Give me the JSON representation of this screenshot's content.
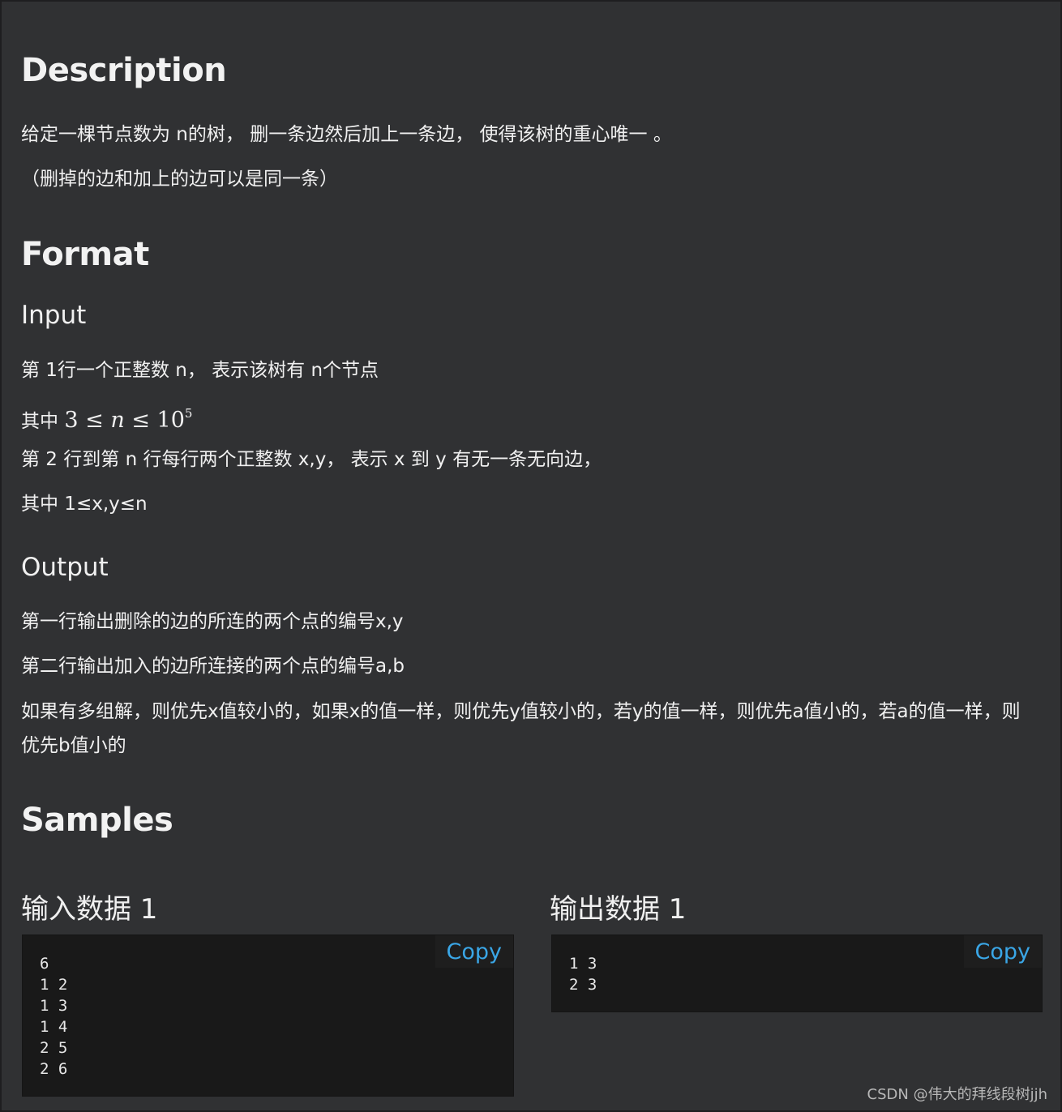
{
  "description": {
    "heading": "Description",
    "line1": "给定一棵节点数为 n的树， 删一条边然后加上一条边， 使得该树的重心唯一 。",
    "line2": "（删掉的边和加上的边可以是同一条）"
  },
  "format": {
    "heading": "Format",
    "input": {
      "heading": "Input",
      "line1": "第 1行一个正整数 n， 表示该树有 n个节点",
      "line2_prefix": "其中 ",
      "line2_math": {
        "low": "3",
        "le": "≤",
        "var": "n",
        "base": "10",
        "exp": "5"
      },
      "line3": "第 2 行到第 n 行每行两个正整数 x,y， 表示 x 到 y 有无一条无向边，",
      "line4": "其中 1≤x,y≤n"
    },
    "output": {
      "heading": "Output",
      "line1": "第一行输出删除的边的所连的两个点的编号x,y",
      "line2": "第二行输出加入的边所连接的两个点的编号a,b",
      "line3": "如果有多组解，则优先x值较小的，如果x的值一样，则优先y值较小的，若y的值一样，则优先a值小的，若a的值一样，则优先b值小的"
    }
  },
  "samples": {
    "heading": "Samples",
    "input": {
      "title": "输入数据 1",
      "copy_label": "Copy",
      "content": "6\n1 2\n1 3\n1 4\n2 5\n2 6"
    },
    "output": {
      "title": "输出数据 1",
      "copy_label": "Copy",
      "content": "1 3\n2 3"
    }
  },
  "watermark": "CSDN @伟大的拜线段树jjh",
  "colors": {
    "background": "#303133",
    "code_background": "#191919",
    "copy_link": "#3aa6e6",
    "text": "#f0f0f0"
  }
}
